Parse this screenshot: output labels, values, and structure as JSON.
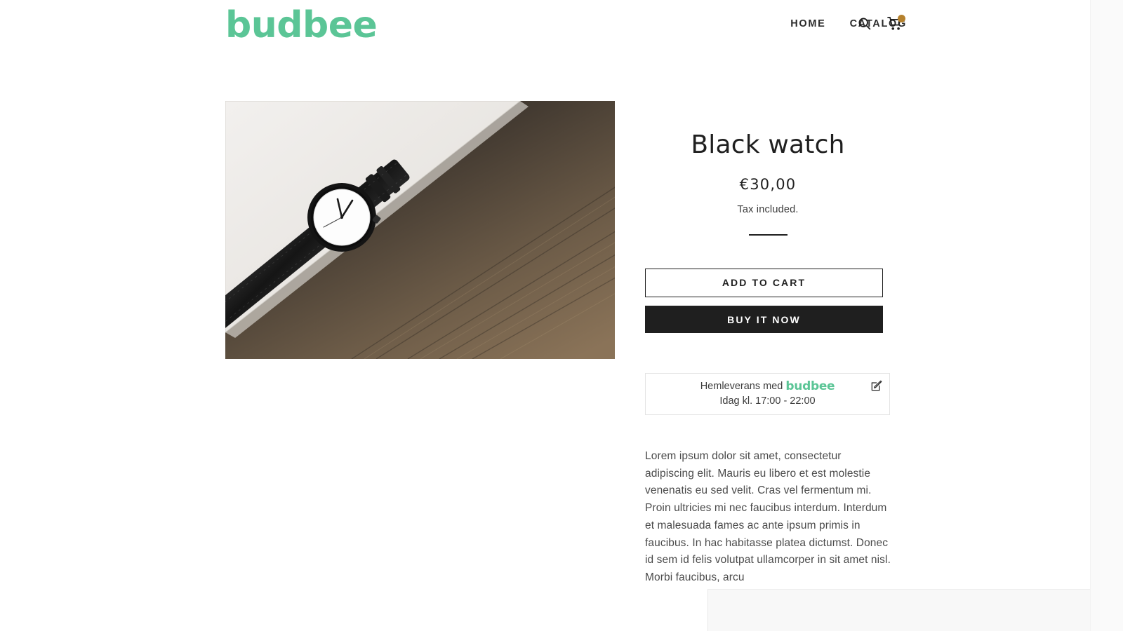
{
  "header": {
    "brand": "budbee",
    "brand_color": "#5bc596",
    "nav": [
      {
        "label": "HOME",
        "name": "nav-link-home"
      },
      {
        "label": "CATALOG",
        "name": "nav-link-catalog"
      }
    ],
    "icons": {
      "search": "search-icon",
      "cart": "cart-icon",
      "cart_badge_color": "#b5812d"
    }
  },
  "product": {
    "image_alt": "Black watch on white marble over dark wood",
    "title": "Black watch",
    "price": "€30,00",
    "tax_note": "Tax included.",
    "add_to_cart_label": "ADD TO CART",
    "buy_now_label": "BUY IT NOW",
    "description": "Lorem ipsum dolor sit amet, consectetur adipiscing elit. Mauris eu libero et est molestie venenatis eu sed velit. Cras vel fermentum mi. Proin ultricies mi nec faucibus interdum. Interdum et malesuada fames ac ante ipsum primis in faucibus. In hac habitasse platea dictumst. Donec id sem id felis volutpat ullamcorper in sit amet nisl. Morbi faucibus, arcu"
  },
  "delivery_widget": {
    "line1_prefix": "Hemleverans med",
    "brand": "budbee",
    "line2": "Idag kl. 17:00 - 22:00",
    "edit_icon": "edit-pencil-icon"
  }
}
